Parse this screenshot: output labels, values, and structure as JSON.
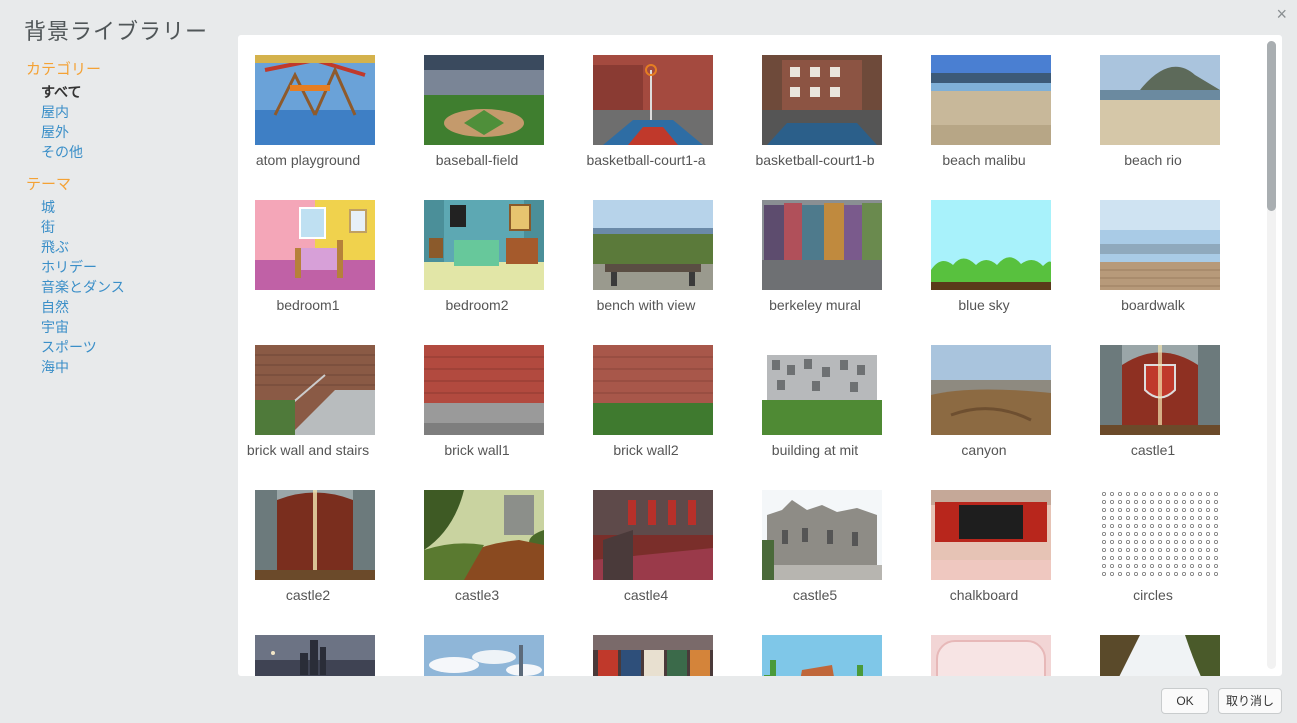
{
  "dialog": {
    "title": "背景ライブラリー",
    "close_glyph": "×",
    "ok_label": "OK",
    "cancel_label": "取り消し"
  },
  "sidebar": {
    "category_head": "カテゴリー",
    "categories": [
      {
        "label": "すべて",
        "selected": true
      },
      {
        "label": "屋内"
      },
      {
        "label": "屋外"
      },
      {
        "label": "その他"
      }
    ],
    "theme_head": "テーマ",
    "themes": [
      {
        "label": "城"
      },
      {
        "label": "街"
      },
      {
        "label": "飛ぶ"
      },
      {
        "label": "ホリデー"
      },
      {
        "label": "音楽とダンス"
      },
      {
        "label": "自然"
      },
      {
        "label": "宇宙"
      },
      {
        "label": "スポーツ"
      },
      {
        "label": "海中"
      }
    ]
  },
  "library": {
    "items": [
      {
        "label": "atom playground",
        "art": "playground"
      },
      {
        "label": "baseball-field",
        "art": "baseball"
      },
      {
        "label": "basketball-court1-a",
        "art": "court-a"
      },
      {
        "label": "basketball-court1-b",
        "art": "court-b"
      },
      {
        "label": "beach malibu",
        "art": "beach-malibu"
      },
      {
        "label": "beach rio",
        "art": "beach-rio"
      },
      {
        "label": "bedroom1",
        "art": "bedroom1"
      },
      {
        "label": "bedroom2",
        "art": "bedroom2"
      },
      {
        "label": "bench with view",
        "art": "bench"
      },
      {
        "label": "berkeley mural",
        "art": "mural"
      },
      {
        "label": "blue sky",
        "art": "bluesky"
      },
      {
        "label": "boardwalk",
        "art": "boardwalk"
      },
      {
        "label": "brick wall and stairs",
        "art": "brick-stairs"
      },
      {
        "label": "brick wall1",
        "art": "brick1"
      },
      {
        "label": "brick wall2",
        "art": "brick2"
      },
      {
        "label": "building at mit",
        "art": "mit"
      },
      {
        "label": "canyon",
        "art": "canyon"
      },
      {
        "label": "castle1",
        "art": "castle1"
      },
      {
        "label": "castle2",
        "art": "castle2"
      },
      {
        "label": "castle3",
        "art": "castle3"
      },
      {
        "label": "castle4",
        "art": "castle4"
      },
      {
        "label": "castle5",
        "art": "castle5"
      },
      {
        "label": "chalkboard",
        "art": "chalkboard"
      },
      {
        "label": "circles",
        "art": "circles"
      },
      {
        "label": "",
        "art": "city-night"
      },
      {
        "label": "",
        "art": "clouds"
      },
      {
        "label": "",
        "art": "clothing"
      },
      {
        "label": "",
        "art": "desert"
      },
      {
        "label": "",
        "art": "pink"
      },
      {
        "label": "",
        "art": "trees"
      }
    ]
  },
  "colors": {
    "accent_orange": "#f4a235",
    "link_blue": "#3b8fc8"
  }
}
